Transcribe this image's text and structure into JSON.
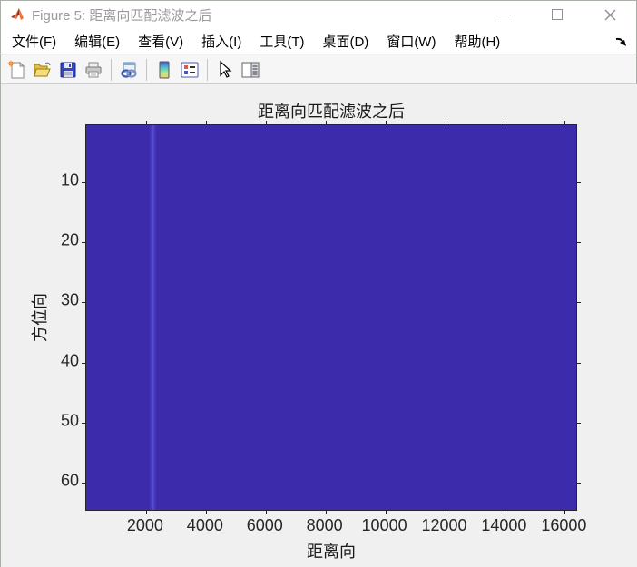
{
  "window": {
    "title": "Figure 5: 距离向匹配滤波之后",
    "app": "MATLAB figure window"
  },
  "menu": {
    "items": [
      "文件(F)",
      "编辑(E)",
      "查看(V)",
      "插入(I)",
      "工具(T)",
      "桌面(D)",
      "窗口(W)",
      "帮助(H)"
    ]
  },
  "toolbar": {
    "icons": [
      "new-figure",
      "open-file",
      "save-figure",
      "print-figure",
      "link-plot",
      "insert-colorbar",
      "insert-legend",
      "edit-plot",
      "property-inspector"
    ]
  },
  "chart_data": {
    "type": "heatmap",
    "title": "距离向匹配滤波之后",
    "xlabel": "距离向",
    "ylabel": "方位向",
    "xlim": [
      0,
      16384
    ],
    "ylim": [
      0.5,
      64.5
    ],
    "x_ticks": [
      2000,
      4000,
      6000,
      8000,
      10000,
      12000,
      14000,
      16000
    ],
    "y_ticks": [
      10,
      20,
      30,
      40,
      50,
      60
    ],
    "bright_line_x": 2230,
    "background_color": "#3c2baa",
    "bright_line_color": "#5a50d8",
    "description": "Uniform dark blue image (value near colormap minimum) with one faint brighter vertical line near x=2230 spanning the full azimuth extent (rows 1-64)."
  },
  "colors": {
    "figure_background": "#f0f0f0",
    "axes_color": "#262626",
    "titlebar_text": "#9a9a9a"
  }
}
